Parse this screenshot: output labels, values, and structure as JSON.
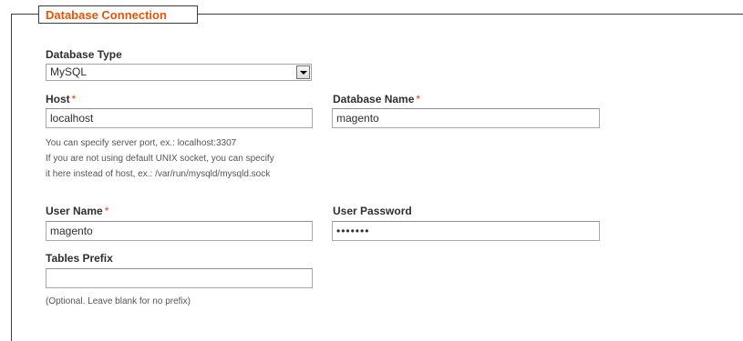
{
  "section": {
    "title": "Database Connection"
  },
  "fields": {
    "db_type": {
      "label": "Database Type",
      "value": "MySQL"
    },
    "host": {
      "label": "Host",
      "required_mark": "*",
      "value": "localhost",
      "note_lines": [
        "You can specify server port, ex.: localhost:3307",
        "If you are not using default UNIX socket, you can specify",
        "it here instead of host, ex.: /var/run/mysqld/mysqld.sock"
      ]
    },
    "db_name": {
      "label": "Database Name",
      "required_mark": "*",
      "value": "magento"
    },
    "user_name": {
      "label": "User Name",
      "required_mark": "*",
      "value": "magento"
    },
    "user_password": {
      "label": "User Password",
      "value": "magento"
    },
    "tables_prefix": {
      "label": "Tables Prefix",
      "value": "",
      "note": "(Optional. Leave blank for no prefix)"
    }
  },
  "colors": {
    "legend_text": "#eb5202",
    "required_star": "#eb340a",
    "label_text": "#2f2f2f"
  }
}
